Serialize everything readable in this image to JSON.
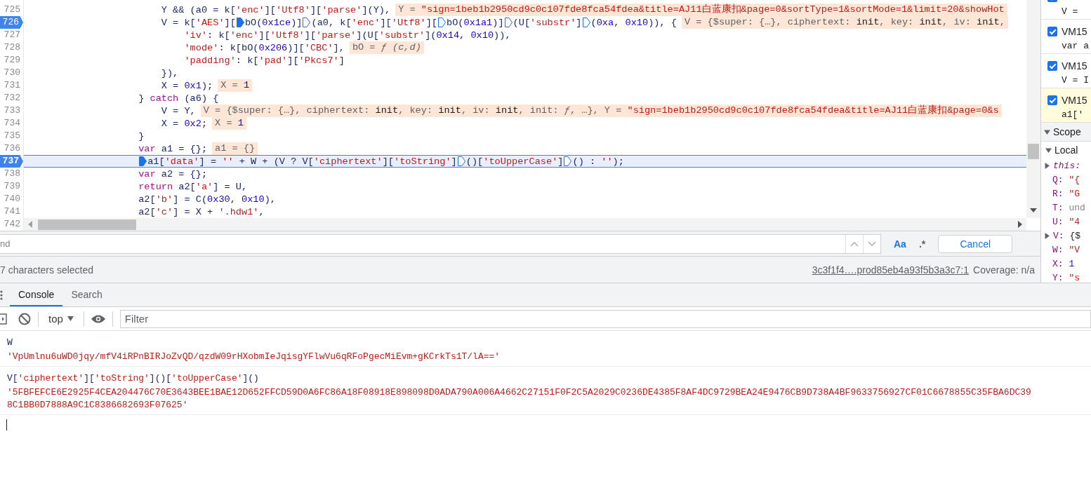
{
  "editor": {
    "lines": [
      {
        "number": "725",
        "breakpoint": false,
        "current": false,
        "segments": [
          {
            "kind": "code",
            "parts": [
              {
                "kind": "plain",
                "text": "                        Y && (a0 = k["
              },
              {
                "kind": "string",
                "text": "'enc'"
              },
              {
                "kind": "plain",
                "text": "]["
              },
              {
                "kind": "string",
                "text": "'Utf8'"
              },
              {
                "kind": "plain",
                "text": "]["
              },
              {
                "kind": "string",
                "text": "'parse'"
              },
              {
                "kind": "plain",
                "text": "](Y),"
              }
            ]
          },
          {
            "kind": "chip",
            "parts": [
              {
                "kind": "label",
                "text": "Y = "
              },
              {
                "kind": "string",
                "text": "\"sign=1beb1b2950cd9c0c107fde8fca54fdea&title=AJ11白蓝康扣&page=0&sortType=1&sortMode=1&limit=20&showHot"
              }
            ]
          }
        ]
      },
      {
        "number": "726",
        "breakpoint": true,
        "current": false,
        "segments": [
          {
            "kind": "code",
            "parts": [
              {
                "kind": "plain",
                "text": "                        V = k["
              },
              {
                "kind": "string",
                "text": "'AES'"
              },
              {
                "kind": "plain",
                "text": "]["
              }
            ]
          },
          {
            "kind": "step",
            "filled": true
          },
          {
            "kind": "code",
            "parts": [
              {
                "kind": "plain",
                "text": "bO("
              },
              {
                "kind": "number",
                "text": "0x1ce"
              },
              {
                "kind": "plain",
                "text": ")]"
              }
            ]
          },
          {
            "kind": "step",
            "filled": false
          },
          {
            "kind": "code",
            "parts": [
              {
                "kind": "plain",
                "text": "(a0, k["
              },
              {
                "kind": "string",
                "text": "'enc'"
              },
              {
                "kind": "plain",
                "text": "]["
              },
              {
                "kind": "string",
                "text": "'Utf8'"
              },
              {
                "kind": "plain",
                "text": "]["
              }
            ]
          },
          {
            "kind": "step",
            "filled": false
          },
          {
            "kind": "code",
            "parts": [
              {
                "kind": "plain",
                "text": "bO("
              },
              {
                "kind": "number",
                "text": "0x1a1"
              },
              {
                "kind": "plain",
                "text": ")]"
              }
            ]
          },
          {
            "kind": "step",
            "filled": false
          },
          {
            "kind": "code",
            "parts": [
              {
                "kind": "plain",
                "text": "(U["
              },
              {
                "kind": "string",
                "text": "'substr'"
              },
              {
                "kind": "plain",
                "text": "]"
              }
            ]
          },
          {
            "kind": "step",
            "filled": false
          },
          {
            "kind": "code",
            "parts": [
              {
                "kind": "plain",
                "text": "("
              },
              {
                "kind": "number",
                "text": "0xa"
              },
              {
                "kind": "plain",
                "text": ", "
              },
              {
                "kind": "number",
                "text": "0x10"
              },
              {
                "kind": "plain",
                "text": ")), {"
              }
            ]
          },
          {
            "kind": "chip",
            "parts": [
              {
                "kind": "label",
                "text": "V = {$super: {…}, ciphertext: "
              },
              {
                "kind": "value",
                "text": "init"
              },
              {
                "kind": "label",
                "text": ", key: "
              },
              {
                "kind": "value",
                "text": "init"
              },
              {
                "kind": "label",
                "text": ", iv: "
              },
              {
                "kind": "value",
                "text": "init"
              },
              {
                "kind": "label",
                "text": ","
              }
            ]
          }
        ]
      },
      {
        "number": "727",
        "breakpoint": false,
        "current": false,
        "segments": [
          {
            "kind": "code",
            "parts": [
              {
                "kind": "string",
                "text": "                            'iv'"
              },
              {
                "kind": "plain",
                "text": ": k["
              },
              {
                "kind": "string",
                "text": "'enc'"
              },
              {
                "kind": "plain",
                "text": "]["
              },
              {
                "kind": "string",
                "text": "'Utf8'"
              },
              {
                "kind": "plain",
                "text": "]["
              },
              {
                "kind": "string",
                "text": "'parse'"
              },
              {
                "kind": "plain",
                "text": "](U["
              },
              {
                "kind": "string",
                "text": "'substr'"
              },
              {
                "kind": "plain",
                "text": "]("
              },
              {
                "kind": "number",
                "text": "0x14"
              },
              {
                "kind": "plain",
                "text": ", "
              },
              {
                "kind": "number",
                "text": "0x10"
              },
              {
                "kind": "plain",
                "text": ")),"
              }
            ]
          }
        ]
      },
      {
        "number": "728",
        "breakpoint": false,
        "current": false,
        "segments": [
          {
            "kind": "code",
            "parts": [
              {
                "kind": "string",
                "text": "                            'mode'"
              },
              {
                "kind": "plain",
                "text": ": k[bO("
              },
              {
                "kind": "number",
                "text": "0x206"
              },
              {
                "kind": "plain",
                "text": ")]["
              },
              {
                "kind": "string",
                "text": "'CBC'"
              },
              {
                "kind": "plain",
                "text": "],"
              }
            ]
          },
          {
            "kind": "chip",
            "parts": [
              {
                "kind": "label",
                "text": "bO = "
              },
              {
                "kind": "function",
                "text": "ƒ (c,d)"
              }
            ]
          }
        ]
      },
      {
        "number": "729",
        "breakpoint": false,
        "current": false,
        "segments": [
          {
            "kind": "code",
            "parts": [
              {
                "kind": "string",
                "text": "                            'padding'"
              },
              {
                "kind": "plain",
                "text": ": k["
              },
              {
                "kind": "string",
                "text": "'pad'"
              },
              {
                "kind": "plain",
                "text": "]["
              },
              {
                "kind": "string",
                "text": "'Pkcs7'"
              },
              {
                "kind": "plain",
                "text": "]"
              }
            ]
          }
        ]
      },
      {
        "number": "730",
        "breakpoint": false,
        "current": false,
        "segments": [
          {
            "kind": "code",
            "parts": [
              {
                "kind": "plain",
                "text": "                        }),"
              }
            ]
          }
        ]
      },
      {
        "number": "731",
        "breakpoint": false,
        "current": false,
        "segments": [
          {
            "kind": "code",
            "parts": [
              {
                "kind": "plain",
                "text": "                        X = "
              },
              {
                "kind": "number",
                "text": "0x1"
              },
              {
                "kind": "plain",
                "text": ");"
              }
            ]
          },
          {
            "kind": "chip",
            "parts": [
              {
                "kind": "label",
                "text": "X = "
              },
              {
                "kind": "number",
                "text": "1"
              }
            ]
          }
        ]
      },
      {
        "number": "732",
        "breakpoint": false,
        "current": false,
        "segments": [
          {
            "kind": "code",
            "parts": [
              {
                "kind": "plain",
                "text": "                    } "
              },
              {
                "kind": "keyword",
                "text": "catch"
              },
              {
                "kind": "plain",
                "text": " (a6) {"
              }
            ]
          }
        ]
      },
      {
        "number": "733",
        "breakpoint": false,
        "current": false,
        "segments": [
          {
            "kind": "code",
            "parts": [
              {
                "kind": "plain",
                "text": "                        V = Y,"
              }
            ]
          },
          {
            "kind": "chip",
            "parts": [
              {
                "kind": "label",
                "text": "V = {$super: {…}, ciphertext: "
              },
              {
                "kind": "value",
                "text": "init"
              },
              {
                "kind": "label",
                "text": ", key: "
              },
              {
                "kind": "value",
                "text": "init"
              },
              {
                "kind": "label",
                "text": ", iv: "
              },
              {
                "kind": "value",
                "text": "init"
              },
              {
                "kind": "label",
                "text": ", init: "
              },
              {
                "kind": "function",
                "text": "ƒ"
              },
              {
                "kind": "label",
                "text": ", …}, Y = "
              },
              {
                "kind": "string",
                "text": "\"sign=1beb1b2950cd9c0c107fde8fca54fdea&title=AJ11白蓝康扣&page=0&s"
              }
            ]
          }
        ]
      },
      {
        "number": "734",
        "breakpoint": false,
        "current": false,
        "segments": [
          {
            "kind": "code",
            "parts": [
              {
                "kind": "plain",
                "text": "                        X = "
              },
              {
                "kind": "number",
                "text": "0x2"
              },
              {
                "kind": "plain",
                "text": ";"
              }
            ]
          },
          {
            "kind": "chip",
            "parts": [
              {
                "kind": "label",
                "text": "X = "
              },
              {
                "kind": "number",
                "text": "1"
              }
            ]
          }
        ]
      },
      {
        "number": "735",
        "breakpoint": false,
        "current": false,
        "segments": [
          {
            "kind": "code",
            "parts": [
              {
                "kind": "plain",
                "text": "                    }"
              }
            ]
          }
        ]
      },
      {
        "number": "736",
        "breakpoint": false,
        "current": false,
        "segments": [
          {
            "kind": "code",
            "parts": [
              {
                "kind": "keyword",
                "text": "                    var"
              },
              {
                "kind": "plain",
                "text": " a1 = {};"
              }
            ]
          },
          {
            "kind": "chip",
            "parts": [
              {
                "kind": "label",
                "text": "a1 = {}"
              }
            ]
          }
        ]
      },
      {
        "number": "737",
        "breakpoint": true,
        "current": true,
        "segments": [
          {
            "kind": "step",
            "filled": true
          },
          {
            "kind": "code",
            "parts": [
              {
                "kind": "plain",
                "text": "a1["
              },
              {
                "kind": "string",
                "text": "'data'"
              },
              {
                "kind": "plain",
                "text": "] = "
              },
              {
                "kind": "string",
                "text": "''"
              },
              {
                "kind": "plain",
                "text": " + W + (V ? V["
              },
              {
                "kind": "string",
                "text": "'ciphertext'"
              },
              {
                "kind": "plain",
                "text": "]["
              },
              {
                "kind": "string",
                "text": "'toString'"
              },
              {
                "kind": "plain",
                "text": "]"
              }
            ]
          },
          {
            "kind": "step",
            "filled": false
          },
          {
            "kind": "code",
            "parts": [
              {
                "kind": "plain",
                "text": "()["
              },
              {
                "kind": "string",
                "text": "'toUpperCase'"
              },
              {
                "kind": "plain",
                "text": "]"
              }
            ]
          },
          {
            "kind": "step",
            "filled": false
          },
          {
            "kind": "code",
            "parts": [
              {
                "kind": "plain",
                "text": "() : "
              },
              {
                "kind": "string",
                "text": "''"
              },
              {
                "kind": "plain",
                "text": ");"
              }
            ]
          }
        ]
      },
      {
        "number": "738",
        "breakpoint": false,
        "current": false,
        "segments": [
          {
            "kind": "code",
            "parts": [
              {
                "kind": "keyword",
                "text": "                    var"
              },
              {
                "kind": "plain",
                "text": " a2 = {};"
              }
            ]
          }
        ]
      },
      {
        "number": "739",
        "breakpoint": false,
        "current": false,
        "segments": [
          {
            "kind": "code",
            "parts": [
              {
                "kind": "keyword",
                "text": "                    return"
              },
              {
                "kind": "plain",
                "text": " a2["
              },
              {
                "kind": "string",
                "text": "'a'"
              },
              {
                "kind": "plain",
                "text": "] = U,"
              }
            ]
          }
        ]
      },
      {
        "number": "740",
        "breakpoint": false,
        "current": false,
        "segments": [
          {
            "kind": "code",
            "parts": [
              {
                "kind": "plain",
                "text": "                    a2["
              },
              {
                "kind": "string",
                "text": "'b'"
              },
              {
                "kind": "plain",
                "text": "] = C("
              },
              {
                "kind": "number",
                "text": "0x30"
              },
              {
                "kind": "plain",
                "text": ", "
              },
              {
                "kind": "number",
                "text": "0x10"
              },
              {
                "kind": "plain",
                "text": "),"
              }
            ]
          }
        ]
      },
      {
        "number": "741",
        "breakpoint": false,
        "current": false,
        "segments": [
          {
            "kind": "code",
            "parts": [
              {
                "kind": "plain",
                "text": "                    a2["
              },
              {
                "kind": "string",
                "text": "'c'"
              },
              {
                "kind": "plain",
                "text": "] = X + "
              },
              {
                "kind": "string",
                "text": "'.hdw1'"
              },
              {
                "kind": "plain",
                "text": ","
              }
            ]
          }
        ]
      },
      {
        "number": "742",
        "breakpoint": false,
        "current": false
      }
    ]
  },
  "find_bar": {
    "placeholder": "nd",
    "case_sensitive": true,
    "regex_label": ".*",
    "case_label": "Aa",
    "cancel": "Cancel"
  },
  "status_bar": {
    "selection": "7 characters selected",
    "source_link": "3c3f1f4….prod85eb4a93f5b3a3c7:1",
    "coverage": "Coverage: n/a"
  },
  "sidebar": {
    "breakpoints": [
      {
        "checked": true,
        "selected": false,
        "code": "V ="
      },
      {
        "checked": true,
        "selected": false,
        "file": "VM15",
        "code": "var a"
      },
      {
        "checked": true,
        "selected": false,
        "file": "VM15",
        "code": "V = I"
      },
      {
        "checked": true,
        "selected": true,
        "file": "VM15",
        "code": "a1['"
      }
    ],
    "scope": {
      "title": "Scope",
      "expanded": true,
      "local": {
        "title": "Local",
        "expanded": true,
        "vars": [
          {
            "name": "this:",
            "kind": "receiver",
            "expandable": true
          },
          {
            "name": "Q:",
            "value": "\"{",
            "kind": "string",
            "expandable": false
          },
          {
            "name": "R:",
            "value": "\"G",
            "kind": "string",
            "expandable": false
          },
          {
            "name": "T:",
            "value": "und",
            "kind": "undefined",
            "expandable": false
          },
          {
            "name": "U:",
            "value": "\"4",
            "kind": "string",
            "expandable": false
          },
          {
            "name": "V:",
            "value": "{$",
            "kind": "object",
            "expandable": true
          },
          {
            "name": "W:",
            "value": "\"V",
            "kind": "string",
            "expandable": false
          },
          {
            "name": "X:",
            "value": "1",
            "kind": "number",
            "expandable": false
          },
          {
            "name": "Y:",
            "value": "\"s",
            "kind": "string",
            "expandable": false
          }
        ]
      }
    }
  },
  "drawer": {
    "tabs": [
      {
        "label": "Console",
        "selected": true
      },
      {
        "label": "Search",
        "selected": false
      }
    ],
    "toolbar": {
      "context": "top",
      "filter_placeholder": "Filter"
    },
    "entries": [
      {
        "kind": "input",
        "parts": [
          {
            "kind": "plain",
            "text": "W"
          }
        ]
      },
      {
        "kind": "result",
        "lines": [
          "'VpUmlnu6uWD0jqy/mfV4iRPnBIRJoZvQD/qzdW09rHXobmIeJqisgYFlwVu6qRFoPgecMiEvm+gKCrkTs1T/lA=='"
        ]
      },
      {
        "kind": "input",
        "parts": [
          {
            "kind": "plain",
            "text": "V["
          },
          {
            "kind": "string",
            "text": "'ciphertext'"
          },
          {
            "kind": "plain",
            "text": "]["
          },
          {
            "kind": "string",
            "text": "'toString'"
          },
          {
            "kind": "plain",
            "text": "]()["
          },
          {
            "kind": "string",
            "text": "'toUpperCase'"
          },
          {
            "kind": "plain",
            "text": "]()"
          }
        ]
      },
      {
        "kind": "result",
        "lines": [
          "'5FBFEFCE6E2925F4CEA204476C70E3643BEE1BAE12D652FFCD59D0A6FC86A18F08918E898098D0ADA790A006A4662C27151F0F2C5A2029C0236DE4385F8AF4DC9729BEA24E9476CB9D738A4BF9633756927CF01C6678855C35FBA6DC39",
          "8C1BB0D7888A9C1C8386682693F07625'"
        ]
      }
    ]
  }
}
